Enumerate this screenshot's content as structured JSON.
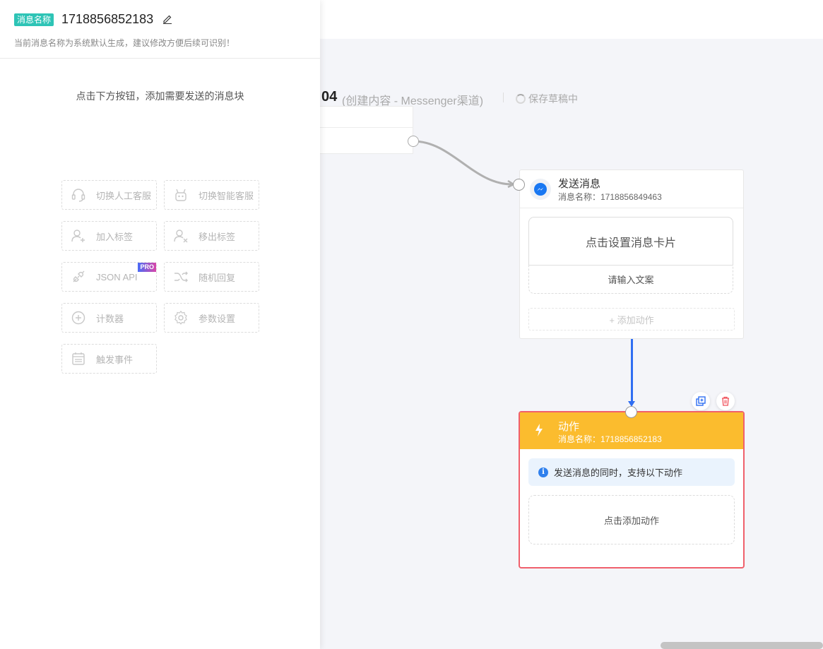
{
  "panel": {
    "name_tag": "消息名称",
    "name_value": "1718856852183",
    "name_hint": "当前消息名称为系统默认生成，建议修改方便后续可识别！",
    "instruction": "点击下方按钮，添加需要发送的消息块",
    "blocks": [
      {
        "label": "切换人工客服",
        "icon": "headset-icon"
      },
      {
        "label": "切换智能客服",
        "icon": "robot-icon"
      },
      {
        "label": "加入标签",
        "icon": "user-add-icon"
      },
      {
        "label": "移出标签",
        "icon": "user-remove-icon"
      },
      {
        "label": "JSON API",
        "icon": "plug-icon",
        "badge": "PRO"
      },
      {
        "label": "随机回复",
        "icon": "shuffle-icon"
      },
      {
        "label": "计数器",
        "icon": "plus-circle-icon"
      },
      {
        "label": "参数设置",
        "icon": "gear-icon"
      },
      {
        "label": "触发事件",
        "icon": "calendar-icon"
      }
    ]
  },
  "flow": {
    "title_fragment": "04",
    "subtitle": "(创建内容 - Messenger渠道)",
    "saving_status": "保存草稿中"
  },
  "send_node": {
    "title": "发送消息",
    "name": "消息名称：1718856849463",
    "card_set": "点击设置消息卡片",
    "text_input": "请输入文案",
    "add_action": "+ 添加动作",
    "icon": "messenger-icon"
  },
  "action_node": {
    "title": "动作",
    "name": "消息名称：1718856852183",
    "info": "发送消息的同时，支持以下动作",
    "add_action": "点击添加动作",
    "icon": "lightning-icon"
  },
  "colors": {
    "accent_teal": "#2ec4b6",
    "action_header": "#fbbc2e",
    "action_border": "#f0606c",
    "connector_blue": "#2f6ef2",
    "info_bg": "#eaf3fd"
  }
}
